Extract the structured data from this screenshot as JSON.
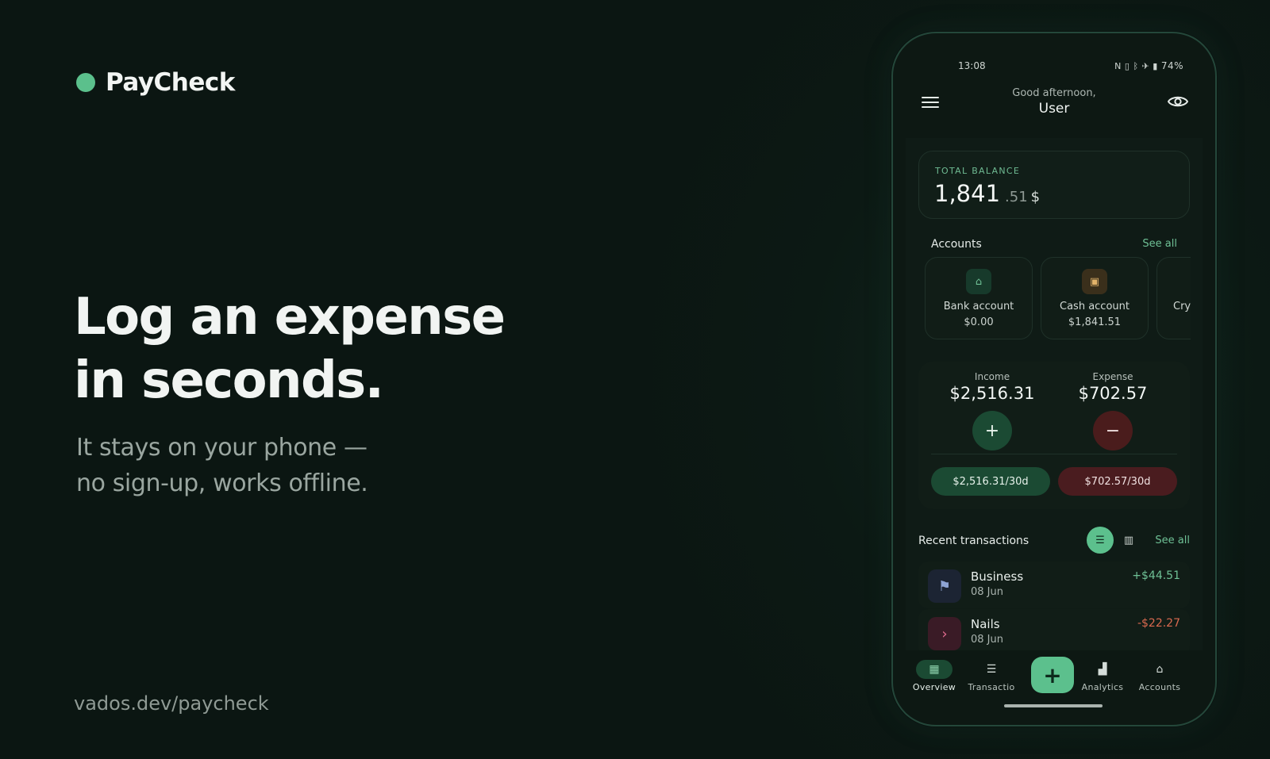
{
  "brand": {
    "name": "PayCheck",
    "dot_color": "#5bc08c"
  },
  "hero": {
    "headline_line1": "Log an expense",
    "headline_line2": "in seconds.",
    "sub_line1": "It stays on your phone —",
    "sub_line2": "no sign-up, works offline."
  },
  "footer": {
    "link": "vados.dev/paycheck"
  },
  "phone": {
    "status": {
      "time": "13:08",
      "battery": "74%",
      "icons": [
        "nfc-icon",
        "vibrate-icon",
        "bluetooth-icon",
        "airplane-icon",
        "battery-icon"
      ]
    },
    "appbar": {
      "greeting": "Good afternoon,",
      "user": "User"
    },
    "balance": {
      "label": "TOTAL BALANCE",
      "integer": "1,841",
      "decimal": ".51",
      "currency": "$"
    },
    "accounts": {
      "title": "Accounts",
      "see_all": "See all",
      "items": [
        {
          "name": "Bank account",
          "amount": "$0.00",
          "icon": "bank-icon"
        },
        {
          "name": "Cash account",
          "amount": "$1,841.51",
          "icon": "wallet-icon"
        },
        {
          "name": "Cry",
          "amount": "",
          "icon": ""
        }
      ]
    },
    "summary": {
      "income_label": "Income",
      "income_value": "$2,516.31",
      "expense_label": "Expense",
      "expense_value": "$702.57",
      "income_pill": "$2,516.31/30d",
      "expense_pill": "$702.57/30d"
    },
    "recent": {
      "title": "Recent transactions",
      "see_all": "See all",
      "items": [
        {
          "name": "Business",
          "date": "08 Jun",
          "amount": "+$44.51",
          "type": "income",
          "icon": "flag-icon"
        },
        {
          "name": "Nails",
          "date": "08 Jun",
          "amount": "-$22.27",
          "type": "expense",
          "icon": "chevron-right-icon"
        }
      ]
    },
    "nav": {
      "items": [
        {
          "label": "Overview",
          "icon": "grid-icon",
          "active": true
        },
        {
          "label": "Transactio",
          "icon": "list-icon",
          "active": false
        },
        {
          "label": "Analytics",
          "icon": "bar-chart-icon",
          "active": false
        },
        {
          "label": "Accounts",
          "icon": "bank-icon",
          "active": false
        }
      ]
    },
    "colors": {
      "accent": "#5cc08d",
      "income": "#6fc196",
      "expense": "#d9694f"
    }
  }
}
